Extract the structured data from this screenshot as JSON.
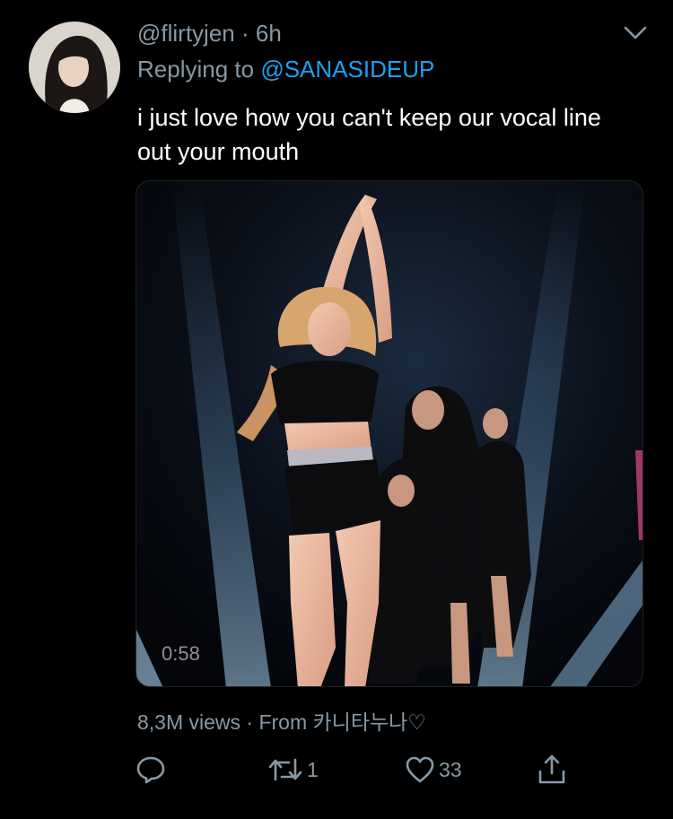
{
  "tweet": {
    "handle": "@flirtyjen",
    "separator": " · ",
    "time": "6h",
    "replying_prefix": "Replying to ",
    "replying_to": "@SANASIDEUP",
    "text": "i just love how you can't keep our vocal line out your mouth",
    "media": {
      "duration": "0:58"
    },
    "meta": "8,3M views · From 카니타누나♡",
    "actions": {
      "reply_icon": "reply-icon",
      "retweet_icon": "retweet-icon",
      "retweet_count": "1",
      "like_icon": "like-icon",
      "like_count": "33",
      "share_icon": "share-icon"
    }
  },
  "colors": {
    "background": "#000000",
    "secondary_text": "#8899a6",
    "link": "#1da1f2",
    "primary_text": "#ffffff"
  }
}
